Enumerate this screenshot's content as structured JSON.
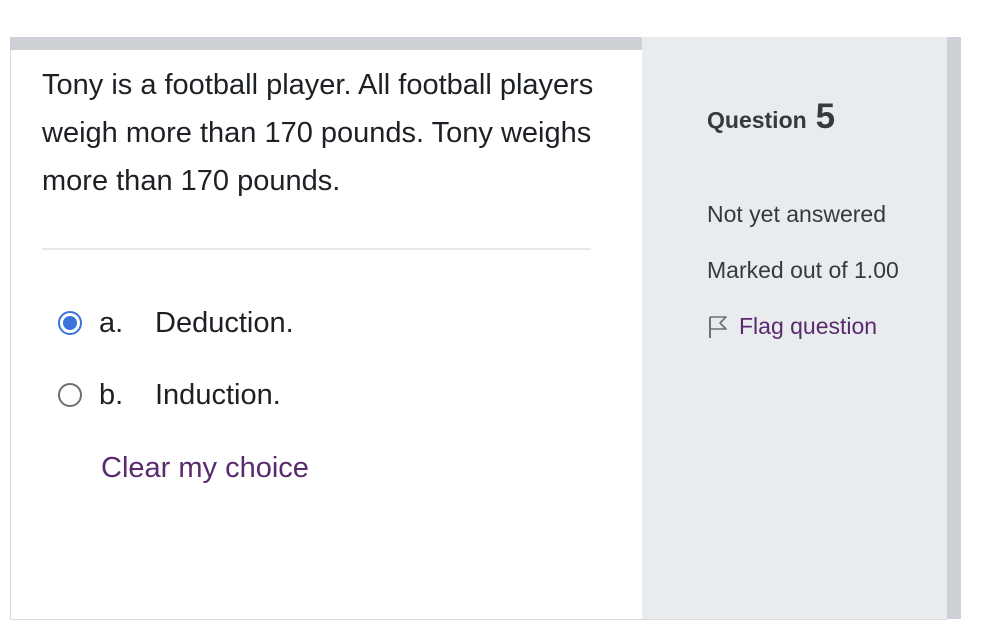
{
  "question": {
    "text": "Tony is a football player. All football players weigh more than 170 pounds. Tony weighs more than 170 pounds."
  },
  "answers": [
    {
      "number": "a.",
      "label": "Deduction.",
      "selected": true
    },
    {
      "number": "b.",
      "label": "Induction.",
      "selected": false
    }
  ],
  "clear_choice_label": "Clear my choice",
  "info": {
    "title_label": "Question",
    "question_number": "5",
    "state": "Not yet answered",
    "grade": "Marked out of 1.00",
    "flag_label": "Flag question",
    "flag_icon": "flag-outline-icon"
  },
  "colors": {
    "accent_radio": "#3a73d9",
    "link": "#5b2a6e",
    "info_panel_bg": "#e9ecef",
    "text": "#1d2125"
  }
}
